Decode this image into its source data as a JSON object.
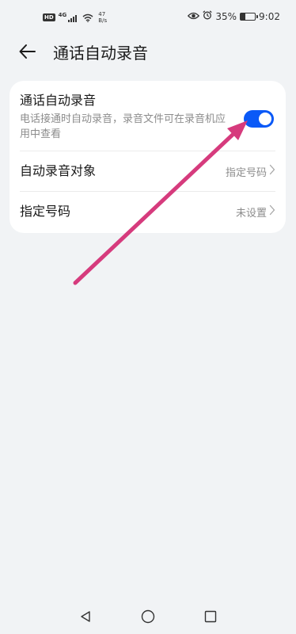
{
  "status_bar": {
    "hd_badge": "HD",
    "network_type": "4G",
    "speed_value": "47",
    "speed_unit": "B/s",
    "battery_percent": "35%",
    "battery_level": 0.35,
    "time": "9:02"
  },
  "header": {
    "title": "通话自动录音"
  },
  "settings": {
    "auto_record": {
      "title": "通话自动录音",
      "description": "电话接通时自动录音，录音文件可在录音机应用中查看",
      "enabled": true
    },
    "record_target": {
      "title": "自动录音对象",
      "value": "指定号码"
    },
    "specified_numbers": {
      "title": "指定号码",
      "value": "未设置"
    }
  },
  "colors": {
    "accent": "#0a59f7",
    "annotation_arrow": "#d63b7d",
    "background": "#f1f3f5"
  },
  "icons": {
    "back": "arrow-left-icon",
    "chevron": "chevron-right-icon",
    "nav_back": "triangle-back-icon",
    "nav_home": "circle-home-icon",
    "nav_recent": "square-recent-icon"
  }
}
